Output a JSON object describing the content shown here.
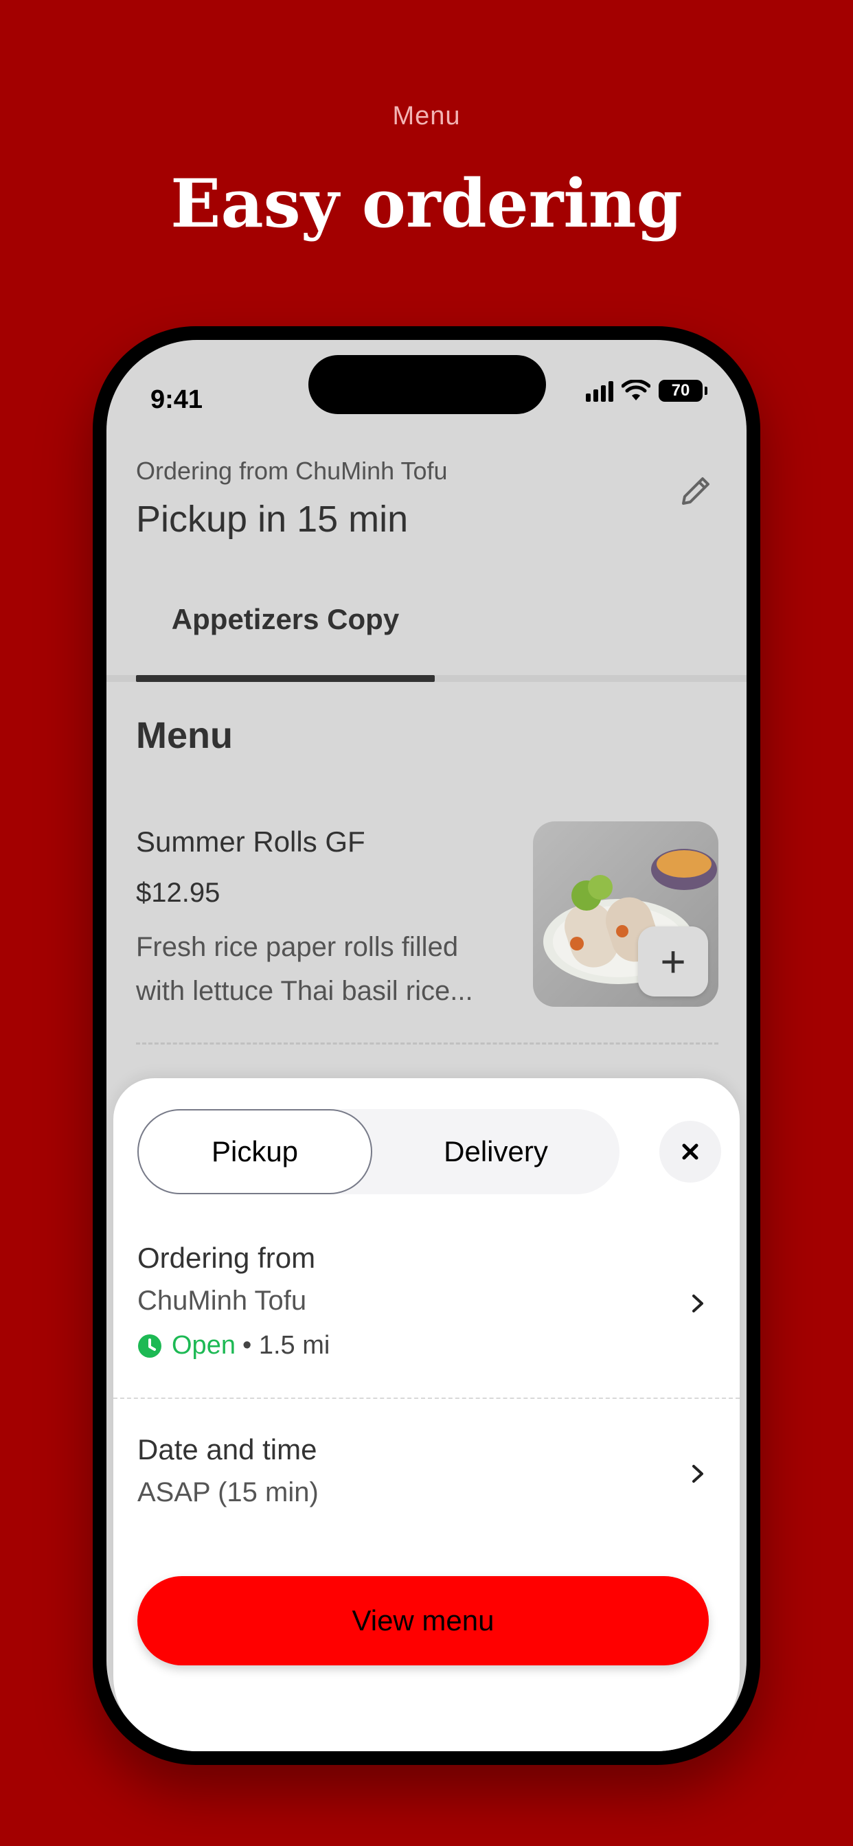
{
  "banner": {
    "eyebrow": "Menu",
    "headline": "Easy ordering"
  },
  "status_bar": {
    "time": "9:41",
    "battery": "70",
    "icons": [
      "signal-icon",
      "wifi-icon",
      "battery-icon"
    ]
  },
  "header": {
    "ordering_from": "Ordering from ChuMinh Tofu",
    "pickup": "Pickup in 15 min",
    "edit_icon": "pencil-icon"
  },
  "tabs": [
    {
      "label": "Appetizers Copy",
      "active": true
    }
  ],
  "menu": {
    "title": "Menu",
    "items": [
      {
        "name": "Summer Rolls GF",
        "price": "$12.95",
        "description": "Fresh rice paper rolls filled with lettuce Thai basil rice...",
        "add_label": "+"
      }
    ]
  },
  "sheet": {
    "toggle": {
      "pickup": "Pickup",
      "delivery": "Delivery",
      "selected": "Pickup"
    },
    "close_icon": "close-icon",
    "ordering": {
      "label": "Ordering from",
      "store": "ChuMinh Tofu",
      "status": "Open",
      "distance": "• 1.5 mi"
    },
    "date_time": {
      "label": "Date and time",
      "value": "ASAP (15 min)"
    },
    "cta": "View menu"
  },
  "colors": {
    "background": "#a30000",
    "cta": "#ff0000",
    "open": "#1db954"
  }
}
